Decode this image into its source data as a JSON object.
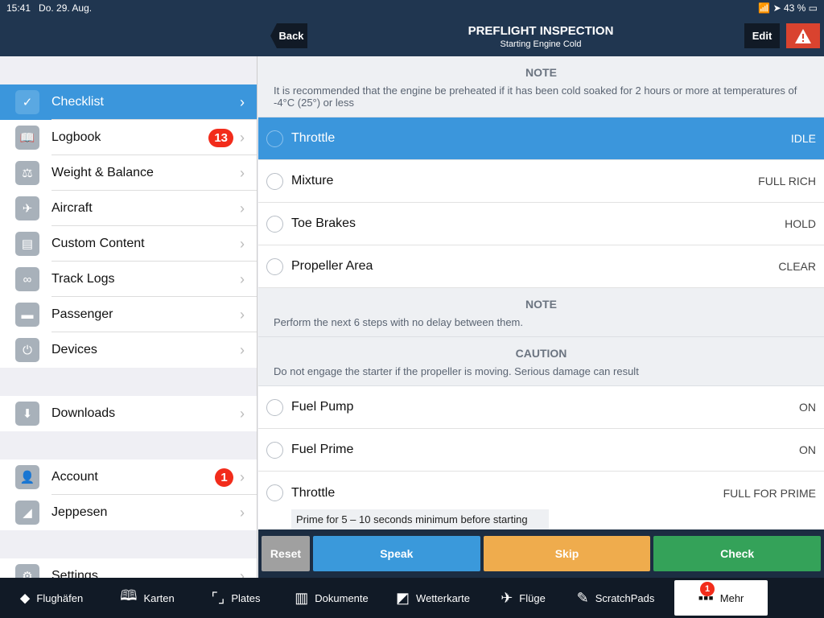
{
  "status": {
    "time": "15:41",
    "date": "Do. 29. Aug.",
    "battery": "43 %"
  },
  "header": {
    "back": "Back",
    "title": "PREFLIGHT INSPECTION",
    "subtitle": "Starting Engine Cold",
    "edit": "Edit"
  },
  "sidebar": {
    "items": [
      {
        "label": "Checklist",
        "icon": "✓",
        "selected": true
      },
      {
        "label": "Logbook",
        "icon": "📖",
        "badge": "13"
      },
      {
        "label": "Weight & Balance",
        "icon": "⚖"
      },
      {
        "label": "Aircraft",
        "icon": "✈"
      },
      {
        "label": "Custom Content",
        "icon": "▤"
      },
      {
        "label": "Track Logs",
        "icon": "∞"
      },
      {
        "label": "Passenger",
        "icon": "▬"
      },
      {
        "label": "Devices",
        "icon": "⏻"
      },
      {
        "label": "Downloads",
        "icon": "⬇"
      },
      {
        "label": "Account",
        "icon": "👤",
        "badge": "1"
      },
      {
        "label": "Jeppesen",
        "icon": "◢"
      },
      {
        "label": "Settings",
        "icon": "⚙"
      }
    ]
  },
  "checklist": {
    "note1": {
      "heading": "NOTE",
      "text": "It is recommended that the engine be preheated if it has been cold soaked for 2 hours or more at temperatures of -4°C (25°) or less"
    },
    "rows1": [
      {
        "name": "Throttle",
        "value": "IDLE",
        "selected": true
      },
      {
        "name": "Mixture",
        "value": "FULL RICH"
      },
      {
        "name": "Toe Brakes",
        "value": "HOLD"
      },
      {
        "name": "Propeller Area",
        "value": "CLEAR"
      }
    ],
    "note2": {
      "heading": "NOTE",
      "text": "Perform the next 6 steps with no delay between them."
    },
    "caution": {
      "heading": "CAUTION",
      "text": "Do not engage the starter if the propeller is moving. Serious damage can result"
    },
    "rows2": [
      {
        "name": "Fuel Pump",
        "value": "ON"
      },
      {
        "name": "Fuel Prime",
        "value": "ON"
      },
      {
        "name": "Throttle",
        "value": "FULL FOR PRIME",
        "sub": "Prime for 5 – 10 seconds minimum before starting"
      }
    ]
  },
  "actions": {
    "reset": "Reset",
    "speak": "Speak",
    "skip": "Skip",
    "check": "Check"
  },
  "colors": {
    "speak": "#3a99db",
    "skip": "#efac4d",
    "check": "#34a259",
    "reset": "#a0a0a0",
    "header": "#203650",
    "accent": "#3b96dc"
  },
  "tabbar": {
    "items": [
      {
        "label": "Flughäfen",
        "icon": "⬥"
      },
      {
        "label": "Karten",
        "icon": "🕮"
      },
      {
        "label": "Plates",
        "icon": "⌜⌟"
      },
      {
        "label": "Dokumente",
        "icon": "▥"
      },
      {
        "label": "Wetterkarte",
        "icon": "◩"
      },
      {
        "label": "Flüge",
        "icon": "✈"
      },
      {
        "label": "ScratchPads",
        "icon": "✎"
      },
      {
        "label": "Mehr",
        "icon": "▪▪▪",
        "badge": "1",
        "selected": true
      }
    ]
  }
}
